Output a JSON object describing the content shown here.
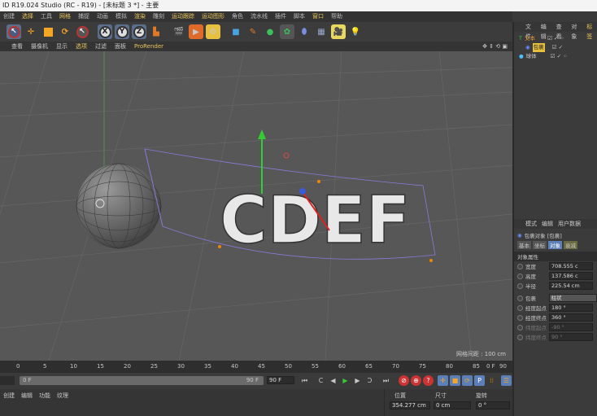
{
  "window": {
    "title": "ID R19.024 Studio (RC - R19) - [未标题 3 *] - 主要"
  },
  "menu": [
    "创建",
    "选择",
    "工具",
    "网格",
    "捕捉",
    "动画",
    "模拟",
    "渲染",
    "雕刻",
    "运动跟踪",
    "运动图形",
    "角色",
    "流水线",
    "插件",
    "脚本",
    "窗口",
    "帮助"
  ],
  "toolbar": {
    "axes": [
      "X",
      "Y",
      "Z"
    ]
  },
  "viewport": {
    "menu": [
      "查看",
      "摄像机",
      "显示",
      "选项",
      "过滤",
      "面板",
      "ProRender"
    ],
    "grid_spacing": "网格间距 : 100 cm",
    "text_object": "CDEF"
  },
  "object_manager": {
    "tabs": [
      "文件",
      "编辑",
      "查看",
      "对象",
      "标签"
    ],
    "objects": [
      {
        "name": "文本"
      },
      {
        "name": "包裹"
      },
      {
        "name": "球体"
      }
    ]
  },
  "attributes": {
    "tabs": [
      "模式",
      "编辑",
      "用户数据"
    ],
    "object_title": "包裹对象 [包裹]",
    "subtabs": [
      "基本",
      "坐标",
      "对象",
      "衰减"
    ],
    "section": "对象属性",
    "fields": [
      {
        "label": "宽度",
        "value": "708.555 c"
      },
      {
        "label": "高度",
        "value": "137.586 c"
      },
      {
        "label": "半径",
        "value": "225.54 cm"
      }
    ],
    "wrap": {
      "label": "包裹",
      "value": "柱状"
    },
    "angles": [
      {
        "label": "经度起点",
        "value": "180 °"
      },
      {
        "label": "经度终点",
        "value": "360 °"
      },
      {
        "label": "纬度起点",
        "value": "-90 °"
      },
      {
        "label": "纬度终点",
        "value": "90 °"
      }
    ]
  },
  "timeline": {
    "ticks": [
      "0",
      "5",
      "10",
      "15",
      "20",
      "25",
      "30",
      "35",
      "40",
      "45",
      "50",
      "55",
      "60",
      "65",
      "70",
      "75",
      "80",
      "85",
      "90"
    ],
    "current_frame": "0 F",
    "start": "0 F",
    "end": "90 F",
    "end_field": "90 F"
  },
  "material_manager": {
    "menu": [
      "创建",
      "编辑",
      "功能",
      "纹理"
    ]
  },
  "coordinates": {
    "headers": [
      "位置",
      "尺寸",
      "旋转"
    ],
    "x_pos": "354.277 cm",
    "x_size": "0 cm",
    "h_rot": "0 °"
  }
}
